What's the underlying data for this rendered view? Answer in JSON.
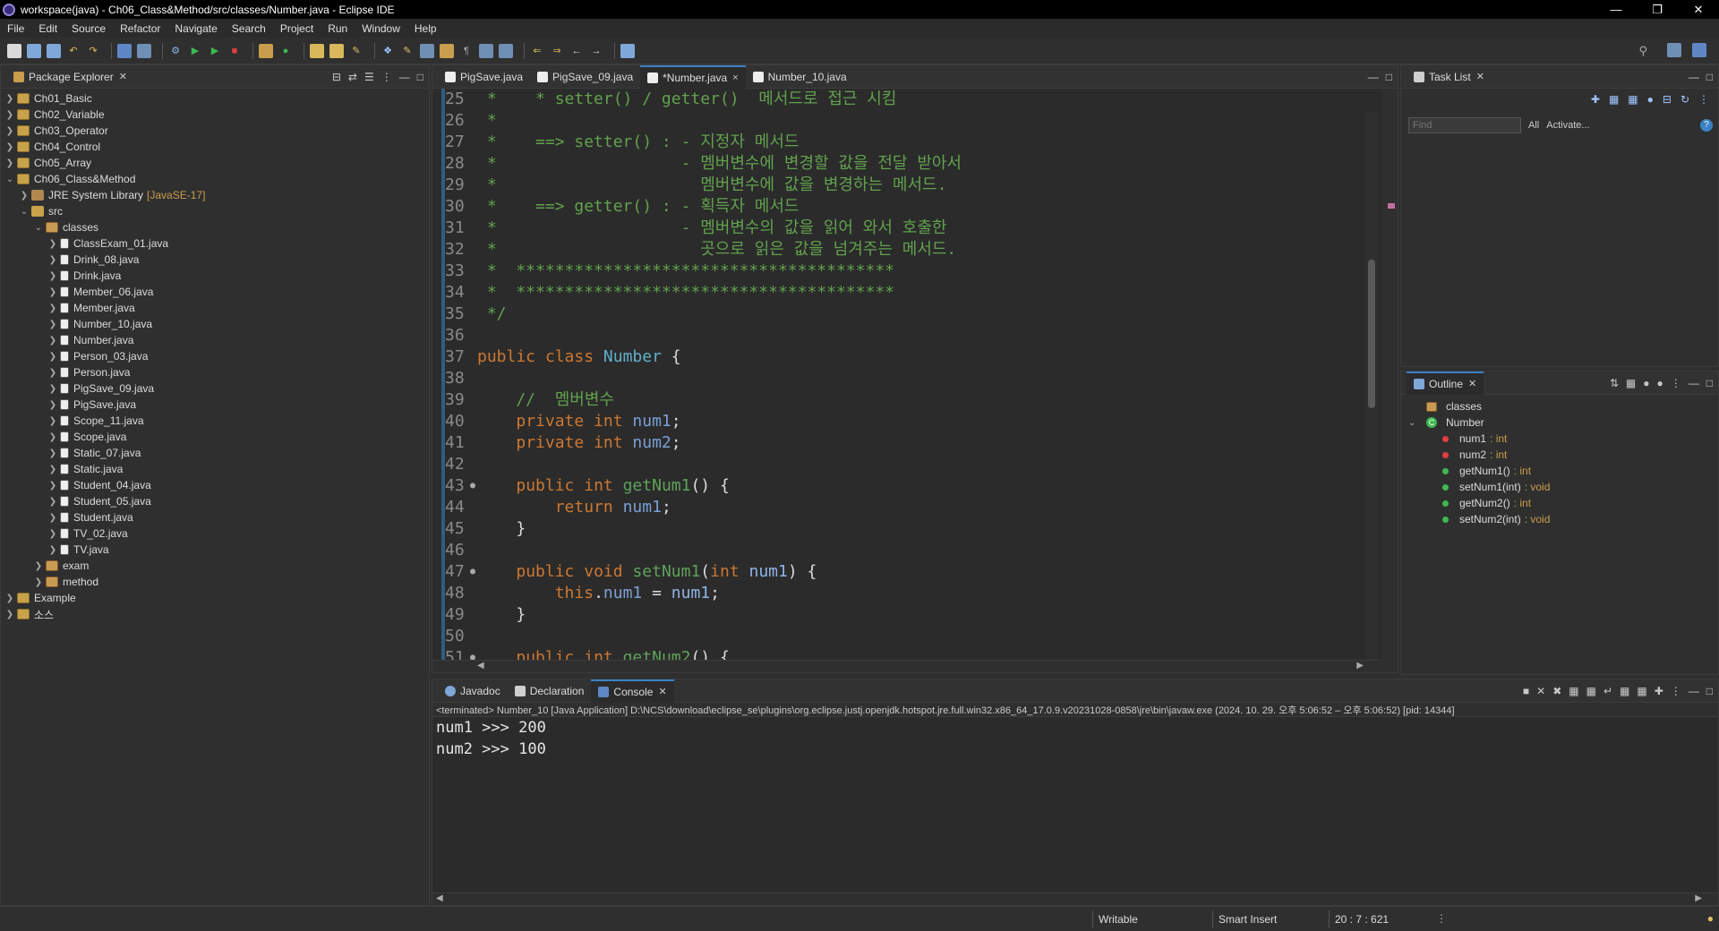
{
  "window": {
    "title": "workspace(java) - Ch06_Class&Method/src/classes/Number.java - Eclipse IDE"
  },
  "menu": [
    "File",
    "Edit",
    "Source",
    "Refactor",
    "Navigate",
    "Search",
    "Project",
    "Run",
    "Window",
    "Help"
  ],
  "package_explorer": {
    "title": "Package Explorer",
    "projects": [
      "Ch01_Basic",
      "Ch02_Variable",
      "Ch03_Operator",
      "Ch04_Control",
      "Ch05_Array",
      "Ch06_Class&Method"
    ],
    "jre": {
      "label": "JRE System Library",
      "decoration": "[JavaSE-17]"
    },
    "src": "src",
    "package_classes": "classes",
    "files": [
      "ClassExam_01.java",
      "Drink_08.java",
      "Drink.java",
      "Member_06.java",
      "Member.java",
      "Number_10.java",
      "Number.java",
      "Person_03.java",
      "Person.java",
      "PigSave_09.java",
      "PigSave.java",
      "Scope_11.java",
      "Scope.java",
      "Static_07.java",
      "Static.java",
      "Student_04.java",
      "Student_05.java",
      "Student.java",
      "TV_02.java",
      "TV.java"
    ],
    "package_exam": "exam",
    "package_method": "method",
    "other_projects": [
      "Example",
      "소스"
    ]
  },
  "editor": {
    "tabs": [
      {
        "label": "PigSave.java"
      },
      {
        "label": "PigSave_09.java"
      },
      {
        "label": "*Number.java",
        "close": "×"
      },
      {
        "label": "Number_10.java"
      }
    ],
    "line_numbers": [
      "25",
      "26",
      "27",
      "28",
      "29",
      "30",
      "31",
      "32",
      "33",
      "34",
      "35",
      "36",
      "37",
      "38",
      "39",
      "40",
      "41",
      "42",
      "43",
      "44",
      "45",
      "46",
      "47",
      "48",
      "49",
      "50",
      "51"
    ],
    "lines": {
      "l25": " *    * setter() / getter()  메서드로 접근 시킴",
      "l26": " *",
      "l27": " *    ==> setter() : - 지정자 메서드",
      "l28": " *                   - 멤버변수에 변경할 값을 전달 받아서",
      "l29": " *                     멤버변수에 값을 변경하는 메서드.",
      "l30": " *    ==> getter() : - 획득자 메서드",
      "l31": " *                   - 멤버변수의 값을 읽어 와서 호출한",
      "l32": " *                     곳으로 읽은 값을 넘겨주는 메서드.",
      "l33": " *  ***************************************",
      "l34": " *  ***************************************",
      "l35": " */",
      "l39": "    //  멤버변수",
      "kw_public": "public",
      "kw_class": "class",
      "kw_private": "private",
      "kw_int": "int",
      "kw_void": "void",
      "kw_return": "return",
      "kw_this": "this",
      "class_name": "Number",
      "num1": "num1",
      "num2": "num2",
      "getNum1": "getNum1",
      "setNum1": "setNum1",
      "getNum2": "getNum2"
    }
  },
  "task_list": {
    "title": "Task List",
    "find_placeholder": "Find",
    "all": "All",
    "activate": "Activate..."
  },
  "outline": {
    "title": "Outline",
    "items": [
      {
        "label": "classes",
        "type": ""
      },
      {
        "label": "Number",
        "type": ""
      },
      {
        "label": "num1",
        "type": " : int"
      },
      {
        "label": "num2",
        "type": " : int"
      },
      {
        "label": "getNum1()",
        "type": " : int"
      },
      {
        "label": "setNum1(int)",
        "type": " : void"
      },
      {
        "label": "getNum2()",
        "type": " : int"
      },
      {
        "label": "setNum2(int)",
        "type": " : void"
      }
    ]
  },
  "console": {
    "tabs": [
      "Javadoc",
      "Declaration",
      "Console"
    ],
    "terminated": "<terminated> Number_10 [Java Application] D:\\NCS\\download\\eclipse_se\\plugins\\org.eclipse.justj.openjdk.hotspot.jre.full.win32.x86_64_17.0.9.v20231028-0858\\jre\\bin\\javaw.exe  (2024. 10. 29. 오후 5:06:52 – 오후 5:06:52) [pid: 14344]",
    "output": [
      "num1 >>> 200",
      "num2 >>> 100"
    ]
  },
  "status": {
    "writable": "Writable",
    "insert_mode": "Smart Insert",
    "position": "20 : 7 : 621"
  },
  "colors": {
    "accent": "#3b82c4",
    "comment": "#62a14e",
    "keyword": "#cc7832"
  }
}
